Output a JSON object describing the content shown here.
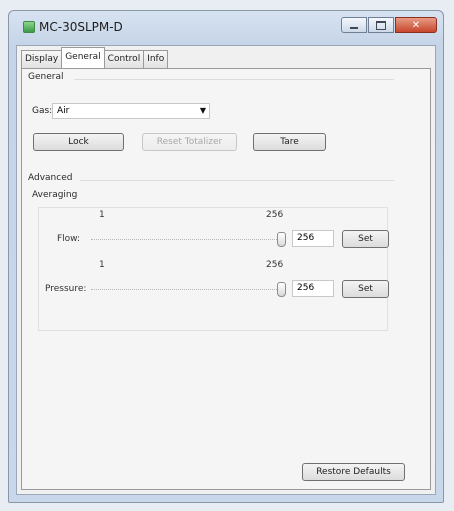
{
  "window": {
    "title": "MC-30SLPM-D"
  },
  "tabs": [
    {
      "label": "Display",
      "active": false
    },
    {
      "label": "General",
      "active": true
    },
    {
      "label": "Control",
      "active": false
    },
    {
      "label": "Info",
      "active": false
    }
  ],
  "general": {
    "section_label": "General",
    "gas": {
      "label": "Gas:",
      "value": "Air"
    },
    "buttons": {
      "lock": "Lock",
      "reset_totalizer": "Reset Totalizer",
      "tare": "Tare"
    }
  },
  "advanced": {
    "section_label": "Advanced",
    "averaging": {
      "label": "Averaging",
      "flow": {
        "label": "Flow:",
        "min": "1",
        "max": "256",
        "value": "256",
        "set_label": "Set"
      },
      "pressure": {
        "label": "Pressure:",
        "min": "1",
        "max": "256",
        "value": "256",
        "set_label": "Set"
      }
    }
  },
  "footer": {
    "restore_defaults": "Restore Defaults"
  }
}
